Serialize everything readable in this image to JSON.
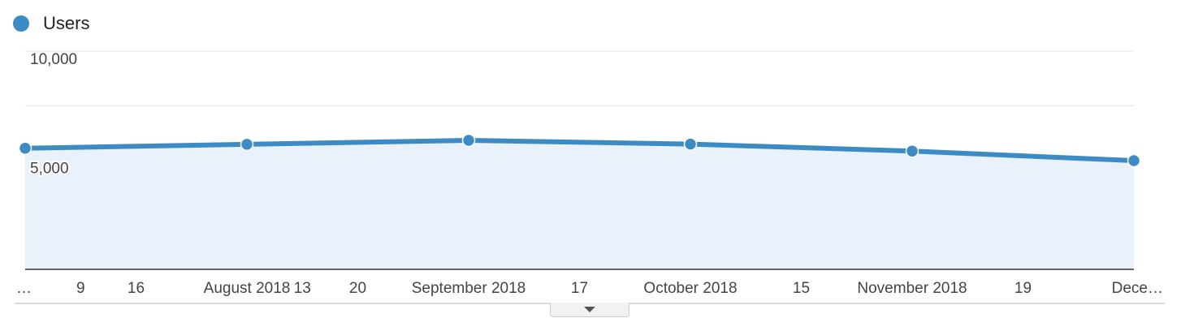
{
  "legend": {
    "label": "Users",
    "color": "#3d8bc4"
  },
  "chart_data": {
    "type": "line",
    "fill": "area",
    "series": [
      {
        "name": "Users",
        "values": [
          5550,
          5730,
          5910,
          5740,
          5420,
          4980
        ]
      }
    ],
    "point_x_ticks": [
      0,
      4,
      8,
      12,
      16,
      20
    ],
    "ylim": [
      0,
      10000
    ],
    "y_ticks": [
      {
        "value": 10000,
        "label": "10,000"
      },
      {
        "value": 5000,
        "label": "5,000"
      }
    ],
    "x_tick_labels": [
      "…",
      "9",
      "16",
      "August 2018",
      "13",
      "20",
      "September 2018",
      "17",
      "October 2018",
      "15",
      "November 2018",
      "19",
      "Dece…"
    ],
    "x_tick_index": [
      0,
      1,
      2,
      4,
      5,
      6,
      8,
      10,
      12,
      14,
      16,
      18,
      20
    ],
    "grid": true,
    "legend_position": "top-left",
    "colors": {
      "line": "#3d8bc4",
      "area": "#e9f1fa",
      "grid": "#e6e6e6",
      "axis": "#333333"
    }
  },
  "controls": {
    "expand_icon": "triangle-down-icon"
  }
}
